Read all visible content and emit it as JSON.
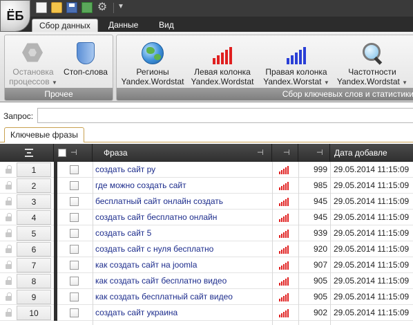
{
  "app": {
    "logo": "ЁБ"
  },
  "quick_access": {
    "icons": [
      "new-file-icon",
      "open-folder-icon",
      "save-icon",
      "export-icon",
      "settings-gear-icon"
    ]
  },
  "ribbon": {
    "tabs": [
      {
        "label": "Сбор данных",
        "active": true
      },
      {
        "label": "Данные",
        "active": false
      },
      {
        "label": "Вид",
        "active": false
      }
    ],
    "groups": {
      "other": {
        "title": "Прочее",
        "buttons": [
          {
            "label_line1": "Остановка",
            "label_line2": "процессов",
            "icon": "hexagon-stop-icon",
            "enabled": false
          },
          {
            "label_line1": "Стоп-слова",
            "label_line2": "",
            "icon": "shield-icon",
            "enabled": true
          }
        ]
      },
      "collect": {
        "title": "Сбор ключевых слов и статистики",
        "buttons": [
          {
            "label_line1": "Регионы",
            "label_line2": "Yandex.Wordstat",
            "icon": "globe-icon"
          },
          {
            "label_line1": "Левая колонка",
            "label_line2": "Yandex.Wordstat",
            "icon": "red-bars-icon"
          },
          {
            "label_line1": "Правая колонка",
            "label_line2": "Yandex.Worstat",
            "icon": "blue-bars-icon"
          },
          {
            "label_line1": "Частотности",
            "label_line2": "Yandex.Wordstat",
            "icon": "magnifier-icon"
          }
        ]
      }
    }
  },
  "query": {
    "label": "Запрос:",
    "value": ""
  },
  "doc_tab": {
    "label": "Ключевые фразы"
  },
  "grid": {
    "columns": {
      "phrase": "Фраза",
      "date": "Дата добавле"
    },
    "pin_glyph": "⊣",
    "rows": [
      {
        "num": "1",
        "phrase": "создать сайт ру",
        "freq": "999",
        "date": "29.05.2014 11:15:09"
      },
      {
        "num": "2",
        "phrase": "где можно создать сайт",
        "freq": "985",
        "date": "29.05.2014 11:15:09"
      },
      {
        "num": "3",
        "phrase": "бесплатный сайт онлайн создать",
        "freq": "945",
        "date": "29.05.2014 11:15:09"
      },
      {
        "num": "4",
        "phrase": "создать сайт бесплатно онлайн",
        "freq": "945",
        "date": "29.05.2014 11:15:09"
      },
      {
        "num": "5",
        "phrase": "создать сайт 5",
        "freq": "939",
        "date": "29.05.2014 11:15:09"
      },
      {
        "num": "6",
        "phrase": "создать сайт с нуля бесплатно",
        "freq": "920",
        "date": "29.05.2014 11:15:09"
      },
      {
        "num": "7",
        "phrase": "как создать сайт на joomla",
        "freq": "907",
        "date": "29.05.2014 11:15:09"
      },
      {
        "num": "8",
        "phrase": "как создать сайт бесплатно видео",
        "freq": "905",
        "date": "29.05.2014 11:15:09"
      },
      {
        "num": "9",
        "phrase": "как создать бесплатный сайт видео",
        "freq": "905",
        "date": "29.05.2014 11:15:09"
      },
      {
        "num": "10",
        "phrase": "создать сайт украина",
        "freq": "902",
        "date": "29.05.2014 11:15:09"
      }
    ]
  }
}
